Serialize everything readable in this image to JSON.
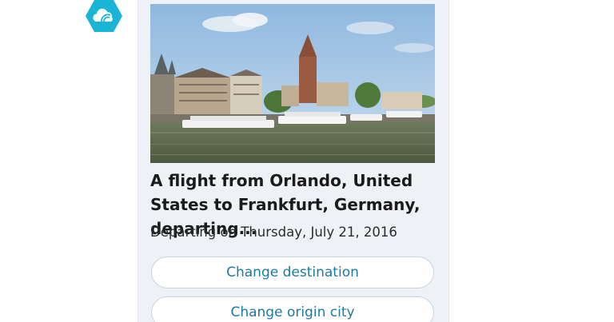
{
  "bot": {
    "avatar_icon": "skype-travel-cloud-icon",
    "accent_color": "#1ab4d6"
  },
  "card": {
    "image_icon": "frankfurt-river-photo",
    "title": "A flight from Orlando, United States to Frankfurt, Germany, departing...",
    "subtitle": "Departing on Thursday, July 21, 2016",
    "actions": [
      {
        "label": "Change destination"
      },
      {
        "label": "Change origin city"
      }
    ],
    "action_color": "#1c7aa3"
  }
}
